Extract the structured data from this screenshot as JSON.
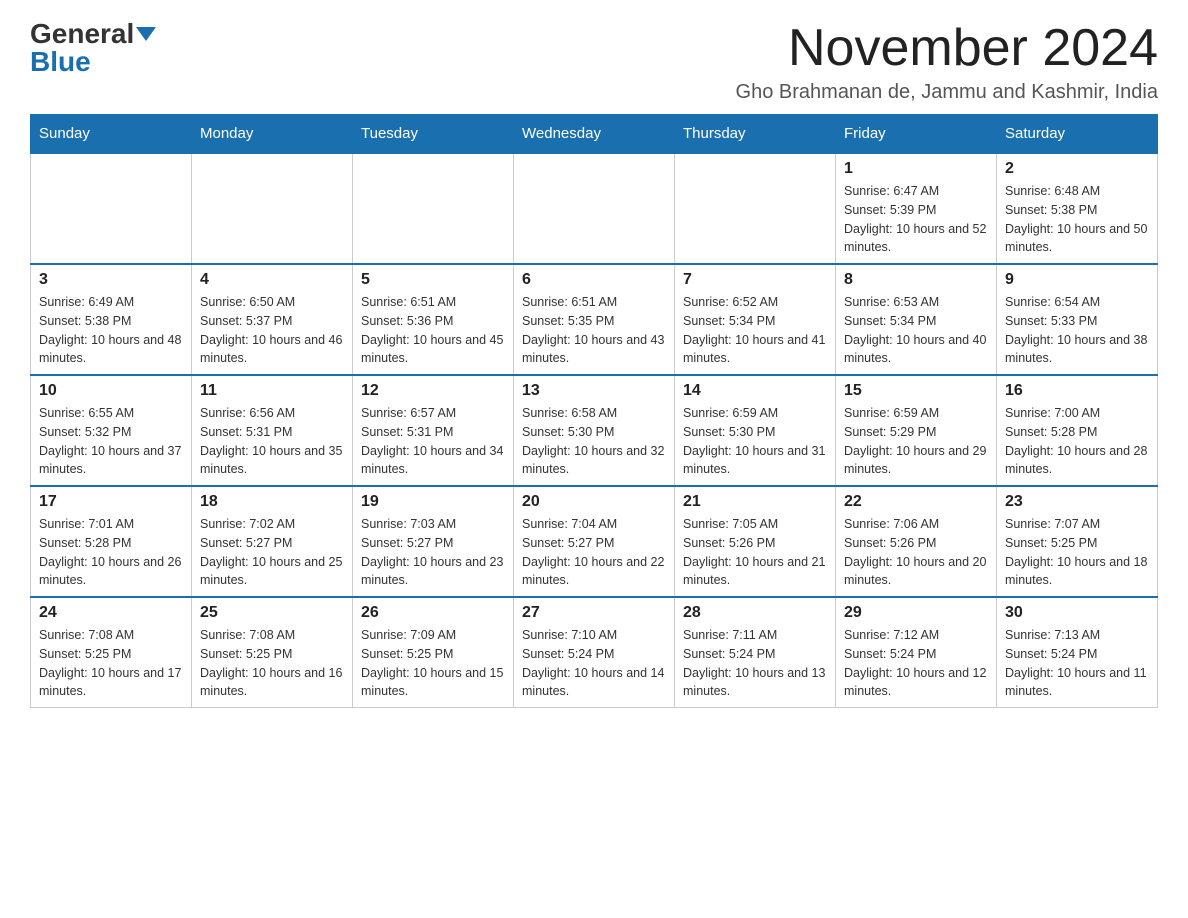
{
  "logo": {
    "general": "General",
    "blue": "Blue"
  },
  "header": {
    "title": "November 2024",
    "subtitle": "Gho Brahmanan de, Jammu and Kashmir, India"
  },
  "weekdays": [
    "Sunday",
    "Monday",
    "Tuesday",
    "Wednesday",
    "Thursday",
    "Friday",
    "Saturday"
  ],
  "weeks": [
    [
      {
        "day": "",
        "info": ""
      },
      {
        "day": "",
        "info": ""
      },
      {
        "day": "",
        "info": ""
      },
      {
        "day": "",
        "info": ""
      },
      {
        "day": "",
        "info": ""
      },
      {
        "day": "1",
        "info": "Sunrise: 6:47 AM\nSunset: 5:39 PM\nDaylight: 10 hours and 52 minutes."
      },
      {
        "day": "2",
        "info": "Sunrise: 6:48 AM\nSunset: 5:38 PM\nDaylight: 10 hours and 50 minutes."
      }
    ],
    [
      {
        "day": "3",
        "info": "Sunrise: 6:49 AM\nSunset: 5:38 PM\nDaylight: 10 hours and 48 minutes."
      },
      {
        "day": "4",
        "info": "Sunrise: 6:50 AM\nSunset: 5:37 PM\nDaylight: 10 hours and 46 minutes."
      },
      {
        "day": "5",
        "info": "Sunrise: 6:51 AM\nSunset: 5:36 PM\nDaylight: 10 hours and 45 minutes."
      },
      {
        "day": "6",
        "info": "Sunrise: 6:51 AM\nSunset: 5:35 PM\nDaylight: 10 hours and 43 minutes."
      },
      {
        "day": "7",
        "info": "Sunrise: 6:52 AM\nSunset: 5:34 PM\nDaylight: 10 hours and 41 minutes."
      },
      {
        "day": "8",
        "info": "Sunrise: 6:53 AM\nSunset: 5:34 PM\nDaylight: 10 hours and 40 minutes."
      },
      {
        "day": "9",
        "info": "Sunrise: 6:54 AM\nSunset: 5:33 PM\nDaylight: 10 hours and 38 minutes."
      }
    ],
    [
      {
        "day": "10",
        "info": "Sunrise: 6:55 AM\nSunset: 5:32 PM\nDaylight: 10 hours and 37 minutes."
      },
      {
        "day": "11",
        "info": "Sunrise: 6:56 AM\nSunset: 5:31 PM\nDaylight: 10 hours and 35 minutes."
      },
      {
        "day": "12",
        "info": "Sunrise: 6:57 AM\nSunset: 5:31 PM\nDaylight: 10 hours and 34 minutes."
      },
      {
        "day": "13",
        "info": "Sunrise: 6:58 AM\nSunset: 5:30 PM\nDaylight: 10 hours and 32 minutes."
      },
      {
        "day": "14",
        "info": "Sunrise: 6:59 AM\nSunset: 5:30 PM\nDaylight: 10 hours and 31 minutes."
      },
      {
        "day": "15",
        "info": "Sunrise: 6:59 AM\nSunset: 5:29 PM\nDaylight: 10 hours and 29 minutes."
      },
      {
        "day": "16",
        "info": "Sunrise: 7:00 AM\nSunset: 5:28 PM\nDaylight: 10 hours and 28 minutes."
      }
    ],
    [
      {
        "day": "17",
        "info": "Sunrise: 7:01 AM\nSunset: 5:28 PM\nDaylight: 10 hours and 26 minutes."
      },
      {
        "day": "18",
        "info": "Sunrise: 7:02 AM\nSunset: 5:27 PM\nDaylight: 10 hours and 25 minutes."
      },
      {
        "day": "19",
        "info": "Sunrise: 7:03 AM\nSunset: 5:27 PM\nDaylight: 10 hours and 23 minutes."
      },
      {
        "day": "20",
        "info": "Sunrise: 7:04 AM\nSunset: 5:27 PM\nDaylight: 10 hours and 22 minutes."
      },
      {
        "day": "21",
        "info": "Sunrise: 7:05 AM\nSunset: 5:26 PM\nDaylight: 10 hours and 21 minutes."
      },
      {
        "day": "22",
        "info": "Sunrise: 7:06 AM\nSunset: 5:26 PM\nDaylight: 10 hours and 20 minutes."
      },
      {
        "day": "23",
        "info": "Sunrise: 7:07 AM\nSunset: 5:25 PM\nDaylight: 10 hours and 18 minutes."
      }
    ],
    [
      {
        "day": "24",
        "info": "Sunrise: 7:08 AM\nSunset: 5:25 PM\nDaylight: 10 hours and 17 minutes."
      },
      {
        "day": "25",
        "info": "Sunrise: 7:08 AM\nSunset: 5:25 PM\nDaylight: 10 hours and 16 minutes."
      },
      {
        "day": "26",
        "info": "Sunrise: 7:09 AM\nSunset: 5:25 PM\nDaylight: 10 hours and 15 minutes."
      },
      {
        "day": "27",
        "info": "Sunrise: 7:10 AM\nSunset: 5:24 PM\nDaylight: 10 hours and 14 minutes."
      },
      {
        "day": "28",
        "info": "Sunrise: 7:11 AM\nSunset: 5:24 PM\nDaylight: 10 hours and 13 minutes."
      },
      {
        "day": "29",
        "info": "Sunrise: 7:12 AM\nSunset: 5:24 PM\nDaylight: 10 hours and 12 minutes."
      },
      {
        "day": "30",
        "info": "Sunrise: 7:13 AM\nSunset: 5:24 PM\nDaylight: 10 hours and 11 minutes."
      }
    ]
  ]
}
